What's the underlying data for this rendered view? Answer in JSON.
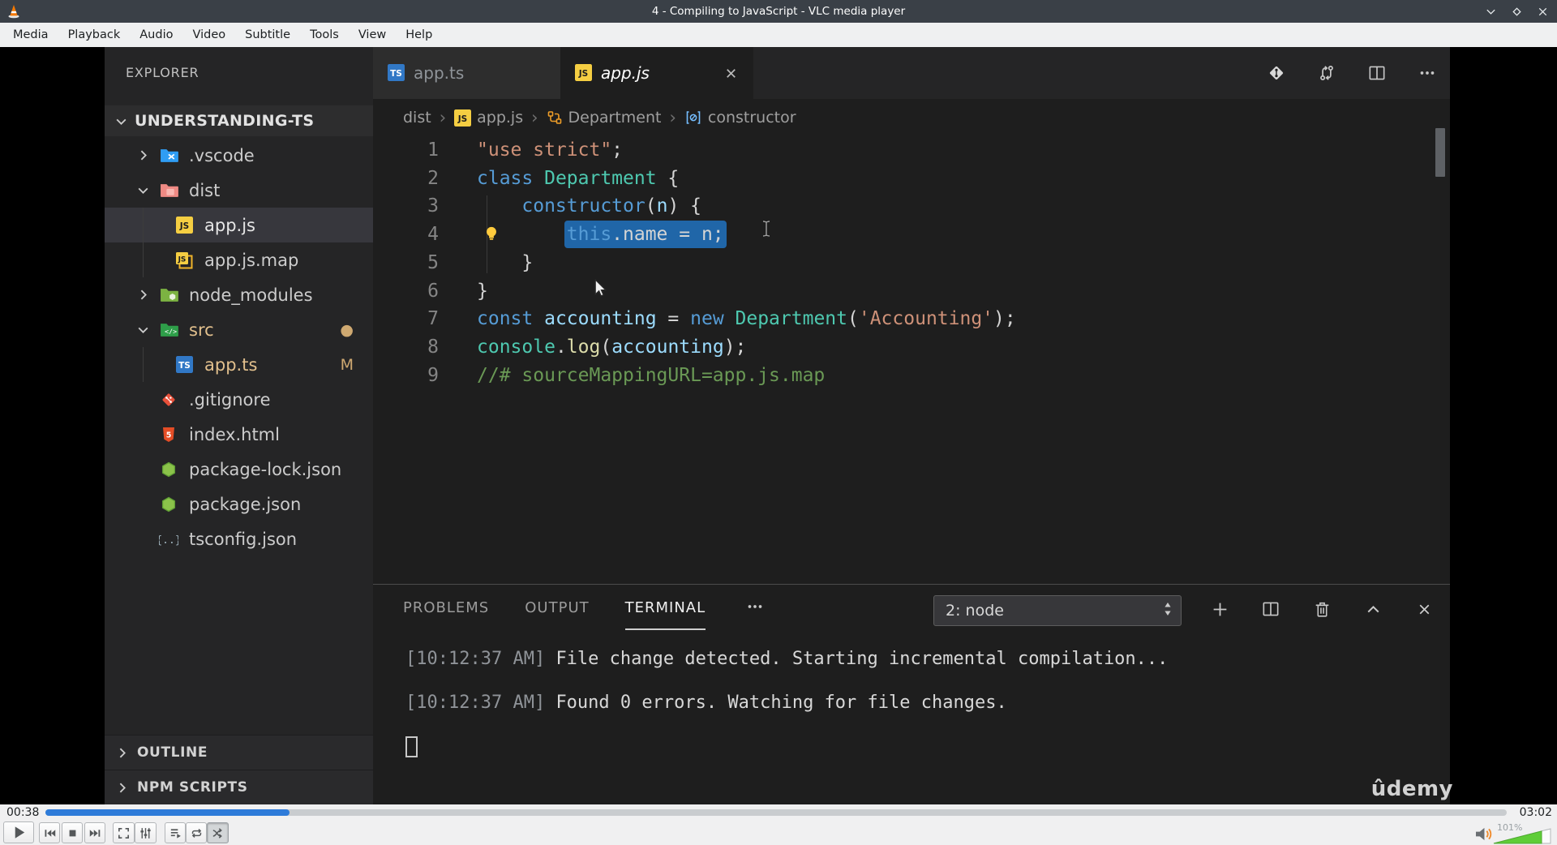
{
  "window": {
    "title": "4 - Compiling to JavaScript - VLC media player",
    "controls": [
      "minimize",
      "maximize",
      "close"
    ]
  },
  "menu_bar": {
    "items": [
      "Media",
      "Playback",
      "Audio",
      "Video",
      "Subtitle",
      "Tools",
      "View",
      "Help"
    ]
  },
  "vscode": {
    "explorer": {
      "header": "EXPLORER",
      "project": "UNDERSTANDING-TS",
      "items": [
        {
          "label": ".vscode",
          "icon": "folder-vscode",
          "chevron": "collapsed",
          "indent": 0
        },
        {
          "label": "dist",
          "icon": "folder-dist",
          "chevron": "expanded",
          "indent": 0
        },
        {
          "label": "app.js",
          "icon": "file-js",
          "indent": 1,
          "selected": true
        },
        {
          "label": "app.js.map",
          "icon": "file-jsmap",
          "indent": 1
        },
        {
          "label": "node_modules",
          "icon": "folder-node",
          "chevron": "collapsed",
          "indent": 0
        },
        {
          "label": "src",
          "icon": "folder-src",
          "chevron": "expanded",
          "indent": 0,
          "modified": true,
          "badge": "●"
        },
        {
          "label": "app.ts",
          "icon": "file-ts",
          "indent": 1,
          "modified": true,
          "badge": "M"
        },
        {
          "label": ".gitignore",
          "icon": "file-git",
          "indent": 0
        },
        {
          "label": "index.html",
          "icon": "file-html",
          "indent": 0
        },
        {
          "label": "package-lock.json",
          "icon": "file-npm",
          "indent": 0
        },
        {
          "label": "package.json",
          "icon": "file-npm",
          "indent": 0
        },
        {
          "label": "tsconfig.json",
          "icon": "file-tsconfig",
          "indent": 0
        }
      ],
      "sections": [
        "OUTLINE",
        "NPM SCRIPTS"
      ]
    },
    "editor_tabs": [
      {
        "label": "app.ts",
        "icon": "file-ts",
        "active": false
      },
      {
        "label": "app.js",
        "icon": "file-js",
        "active": true,
        "preview": true,
        "closable": true
      }
    ],
    "tab_actions": [
      "open-changes",
      "sync",
      "split-editor",
      "more-actions"
    ],
    "breadcrumb": [
      {
        "label": "dist"
      },
      {
        "label": "app.js",
        "icon": "file-js"
      },
      {
        "label": "Department",
        "icon": "symbol-class"
      },
      {
        "label": "constructor",
        "icon": "symbol-method"
      }
    ],
    "code": {
      "lines": [
        {
          "num": 1,
          "tokens": [
            [
              "str",
              "\"use strict\""
            ],
            [
              "pln",
              ";"
            ]
          ]
        },
        {
          "num": 2,
          "tokens": [
            [
              "kw",
              "class "
            ],
            [
              "typ",
              "Department"
            ],
            [
              "pln",
              " {"
            ]
          ]
        },
        {
          "num": 3,
          "tokens": [
            [
              "pln",
              "    "
            ],
            [
              "kw",
              "constructor"
            ],
            [
              "pln",
              "("
            ],
            [
              "prm",
              "n"
            ],
            [
              "pln",
              ") {"
            ]
          ]
        },
        {
          "num": 4,
          "lightbulb": true,
          "tokens": [
            [
              "pln",
              "        "
            ],
            [
              "kw",
              "this",
              "sel"
            ],
            [
              "pln",
              ".name = n;",
              "sel"
            ]
          ]
        },
        {
          "num": 5,
          "tokens": [
            [
              "pln",
              "    }"
            ]
          ]
        },
        {
          "num": 6,
          "tokens": [
            [
              "pln",
              "}"
            ]
          ]
        },
        {
          "num": 7,
          "tokens": [
            [
              "kw",
              "const "
            ],
            [
              "prm",
              "accounting"
            ],
            [
              "pln",
              " = "
            ],
            [
              "kw",
              "new "
            ],
            [
              "typ",
              "Department"
            ],
            [
              "pln",
              "("
            ],
            [
              "str",
              "'Accounting'"
            ],
            [
              "pln",
              ");"
            ]
          ]
        },
        {
          "num": 8,
          "tokens": [
            [
              "typ",
              "console"
            ],
            [
              "pln",
              "."
            ],
            [
              "fn",
              "log"
            ],
            [
              "pln",
              "("
            ],
            [
              "prm",
              "accounting"
            ],
            [
              "pln",
              ");"
            ]
          ]
        },
        {
          "num": 9,
          "tokens": [
            [
              "com",
              "//# sourceMappingURL=app.js.map"
            ]
          ]
        }
      ]
    },
    "panel": {
      "tabs": [
        {
          "label": "PROBLEMS",
          "active": false
        },
        {
          "label": "OUTPUT",
          "active": false
        },
        {
          "label": "TERMINAL",
          "active": true
        }
      ],
      "terminal_select": "2: node",
      "actions": [
        "new-terminal",
        "split-terminal",
        "kill-terminal",
        "maximize-panel",
        "close-panel"
      ],
      "terminal_lines": [
        {
          "time": "[10:12:37 AM]",
          "message": "File change detected. Starting incremental compilation..."
        },
        {
          "time": "[10:12:37 AM]",
          "message": "Found 0 errors. Watching for file changes."
        }
      ]
    },
    "watermark": "ûdemy"
  },
  "transport": {
    "elapsed": "00:38",
    "duration": "03:02",
    "progress_percent": 16.7,
    "buttons": [
      "play",
      "previous",
      "stop",
      "next",
      "fullscreen",
      "extended-settings",
      "playlist",
      "loop",
      "random"
    ],
    "volume_label": "101%",
    "volume_fill_percent": 85
  },
  "colors": {
    "titlebar": "#3a4047",
    "menubar": "#eff0f1",
    "sidebar_bg": "#252526",
    "editor_bg": "#1e1e1e",
    "selection_bg": "#2066a8",
    "modified_file": "#e2c08d",
    "seek_fill": "#2e7bd9",
    "volume_green": "#5fcd38"
  }
}
